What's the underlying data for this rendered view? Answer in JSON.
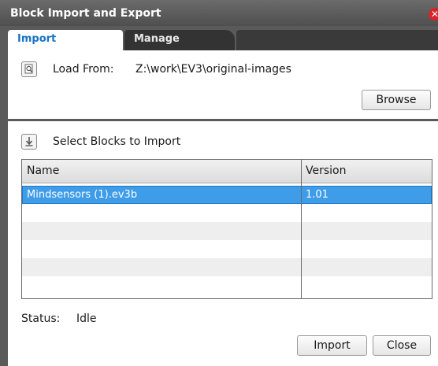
{
  "window": {
    "title": "Block Import and Export",
    "close_glyph": "✕"
  },
  "tabs": [
    {
      "label": "Import",
      "active": true
    },
    {
      "label": "Manage",
      "active": false
    }
  ],
  "load_from": {
    "icon": "folder-search-icon",
    "label": "Load From:",
    "path": "Z:\\work\\EV3\\original-images",
    "browse_label": "Browse"
  },
  "select_blocks": {
    "icon": "download-arrow-icon",
    "label": "Select Blocks to Import"
  },
  "table": {
    "columns": [
      "Name",
      "Version"
    ],
    "rows": [
      {
        "name": "Mindsensors (1).ev3b",
        "version": "1.01",
        "selected": true
      }
    ]
  },
  "status": {
    "label": "Status:",
    "value": "Idle"
  },
  "buttons": {
    "import_label": "Import",
    "close_label": "Close"
  },
  "colors": {
    "selection": "#3f9ce8",
    "active_tab_text": "#1a73c8",
    "close_button": "#d8242a"
  }
}
